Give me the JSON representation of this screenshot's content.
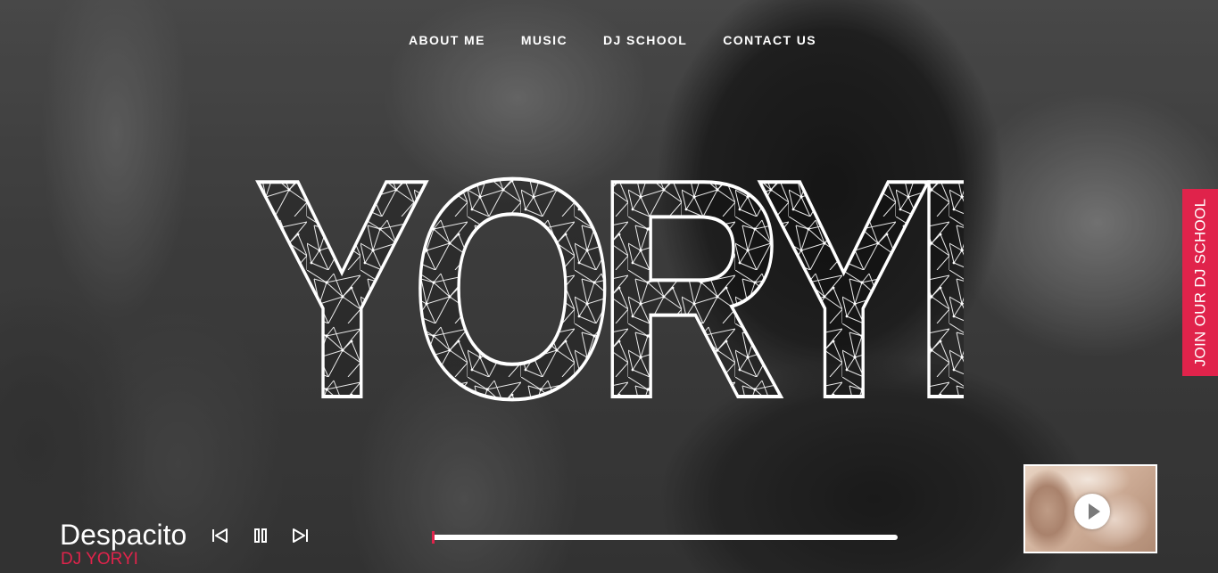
{
  "nav": {
    "items": [
      {
        "label": "ABOUT ME"
      },
      {
        "label": "MUSIC"
      },
      {
        "label": "DJ SCHOOL"
      },
      {
        "label": "CONTACT US"
      }
    ]
  },
  "logo": {
    "text": "YORYI"
  },
  "side_tab": {
    "label": "JOIN OUR DJ SCHOOL"
  },
  "player": {
    "title": "Despacito",
    "artist": "DJ YORYI",
    "progress": 0.0,
    "controls": [
      "previous-icon",
      "pause-icon",
      "next-icon"
    ]
  },
  "video": {
    "icon": "play-icon"
  },
  "colors": {
    "accent": "#e0234b",
    "text": "#ffffff"
  }
}
